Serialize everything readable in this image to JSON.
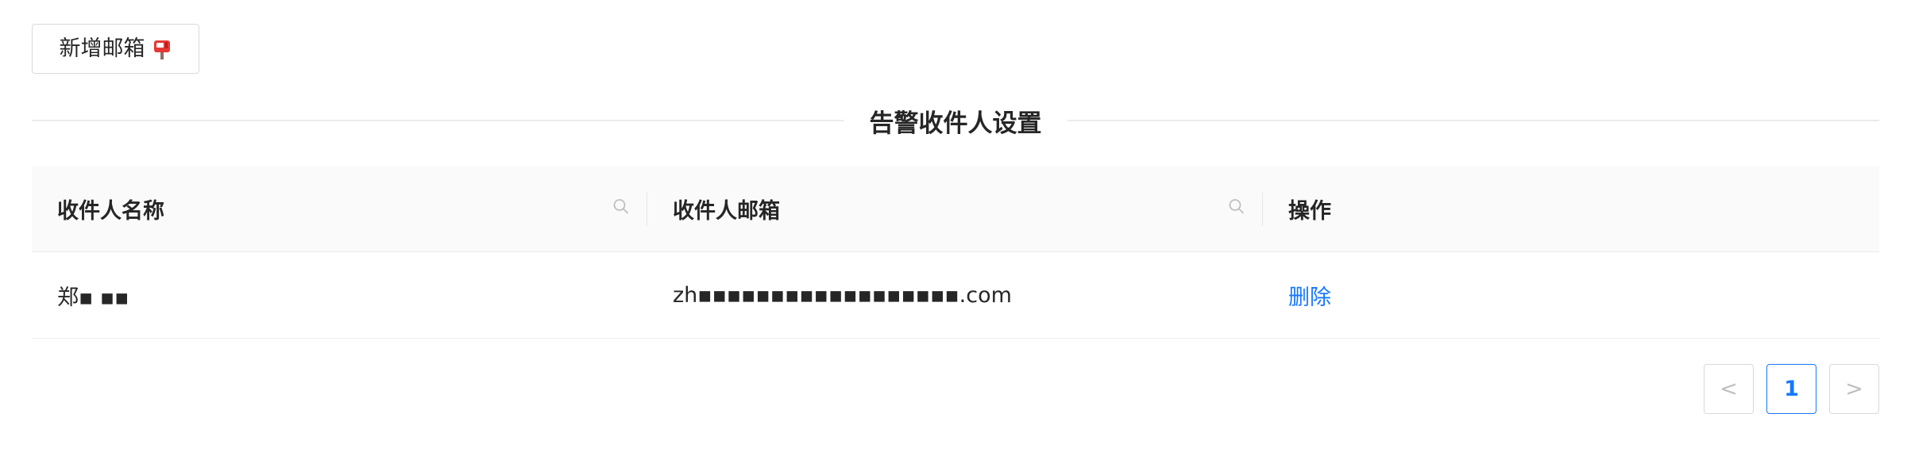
{
  "toolbar": {
    "add_mailbox_label": "新增邮箱",
    "mailbox_icon": "mailbox-icon"
  },
  "section": {
    "title": "告警收件人设置"
  },
  "table": {
    "columns": [
      "收件人名称",
      "收件人邮箱",
      "操作"
    ],
    "filter_icon": "search-icon",
    "rows": [
      {
        "name": "郑▪ ▪▪",
        "email": "zh▪▪▪▪▪▪▪▪▪▪▪▪▪▪▪▪▪▪.com",
        "action": "删除"
      }
    ]
  },
  "pagination": {
    "prev_label": "<",
    "current_page": "1",
    "next_label": ">"
  },
  "colors": {
    "accent": "#1677ff",
    "border": "#d9d9d9",
    "header_bg": "#fafafa"
  }
}
